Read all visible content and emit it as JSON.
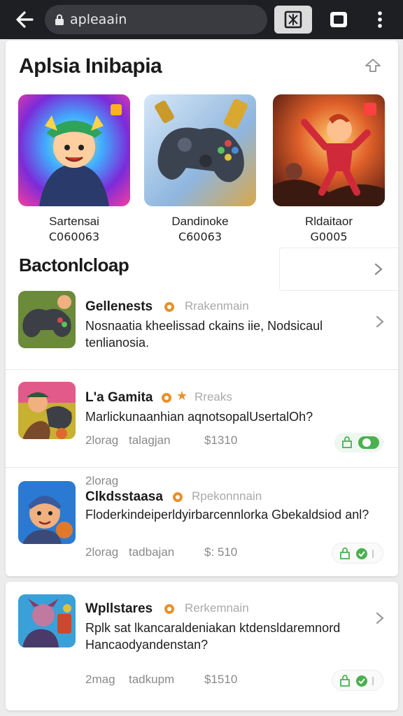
{
  "browser": {
    "url": "apleaain"
  },
  "header": {
    "title": "Aplsia Inibapia"
  },
  "featured": [
    {
      "name": "Sartensai",
      "code": "C060063"
    },
    {
      "name": "Dandinoke",
      "code": "C60063"
    },
    {
      "name": "Rldaitaor",
      "code": "G0005"
    }
  ],
  "section": {
    "title": "Bactonlcloap"
  },
  "list": [
    {
      "title": "Gellenests",
      "tag": "Rrakenmain",
      "desc": "Nosnaatia kheelissad ckains iie, Nodsicaul tenlianosia.",
      "meta_left": "",
      "meta_mid": "",
      "price": ""
    },
    {
      "title": "L'a Gamita",
      "tag": "Rreaks",
      "desc": "Marlickunaanhian aqnotsopalUsertalOh?",
      "meta_left": "2lorag",
      "meta_mid": "talagjan",
      "price": "$1310"
    },
    {
      "title": "Clkdsstaasa",
      "tag": "Rpekonnnain",
      "desc": "Floderkindeiperldyirbarcennlorka Gbekaldsiod anl?",
      "meta_left": "2lorag",
      "meta_mid": "tadbajan",
      "price": "$: 510"
    },
    {
      "title": "Wpllstares",
      "tag": "Rerkemnain",
      "desc": "Rplk sat lkancaraldeniakan ktdensldaremnord Hancaodyandenstan?",
      "meta_left": "2mag",
      "meta_mid": "tadkupm",
      "price": "$1510"
    }
  ],
  "colors": {
    "accent_orange": "#e8902a",
    "toggle_green": "#4caf50",
    "topbar": "#1e1f23"
  }
}
